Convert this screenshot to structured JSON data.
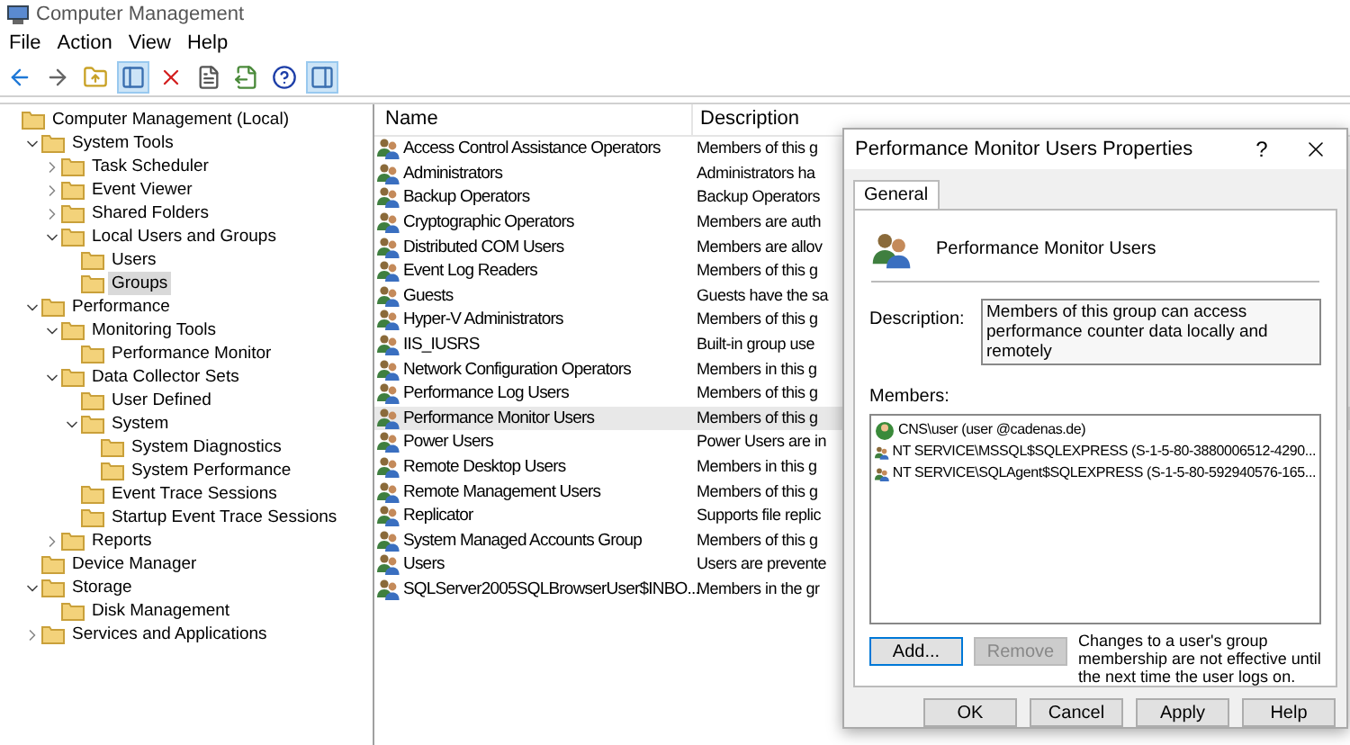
{
  "window": {
    "title": "Computer Management"
  },
  "menu": [
    "File",
    "Action",
    "View",
    "Help"
  ],
  "toolbar": [
    {
      "kind": "back",
      "on": false
    },
    {
      "kind": "forward",
      "on": false
    },
    {
      "kind": "up",
      "on": false
    },
    {
      "kind": "tree",
      "on": true
    },
    {
      "kind": "delete",
      "on": false
    },
    {
      "kind": "properties",
      "on": false
    },
    {
      "kind": "export",
      "on": false
    },
    {
      "kind": "help",
      "on": false
    },
    {
      "kind": "pane",
      "on": true
    }
  ],
  "tree": [
    {
      "label": "Computer Management (Local)",
      "selected": false,
      "children": [
        {
          "label": "System Tools",
          "selected": false,
          "expanded": true,
          "children": [
            {
              "label": "Task Scheduler",
              "selected": false,
              "expanded": false
            },
            {
              "label": "Event Viewer",
              "selected": false,
              "expanded": false
            },
            {
              "label": "Shared Folders",
              "selected": false,
              "expanded": false
            },
            {
              "label": "Local Users and Groups",
              "selected": false,
              "expanded": true,
              "children": [
                {
                  "label": "Users",
                  "selected": false
                },
                {
                  "label": "Groups",
                  "selected": true
                }
              ]
            }
          ]
        },
        {
          "label": "Performance",
          "selected": false,
          "expanded": true,
          "children": [
            {
              "label": "Monitoring Tools",
              "selected": false,
              "expanded": true,
              "children": [
                {
                  "label": "Performance Monitor",
                  "selected": false
                }
              ]
            },
            {
              "label": "Data Collector Sets",
              "selected": false,
              "expanded": true,
              "children": [
                {
                  "label": "User Defined",
                  "selected": false
                },
                {
                  "label": "System",
                  "selected": false,
                  "expanded": true,
                  "children": [
                    {
                      "label": "System Diagnostics",
                      "selected": false
                    },
                    {
                      "label": "System Performance",
                      "selected": false
                    }
                  ]
                },
                {
                  "label": "Event Trace Sessions",
                  "selected": false
                },
                {
                  "label": "Startup Event Trace Sessions",
                  "selected": false
                }
              ]
            },
            {
              "label": "Reports",
              "selected": false,
              "expanded": false
            }
          ]
        },
        {
          "label": "Device Manager",
          "selected": false
        },
        {
          "label": "Storage",
          "selected": false,
          "expanded": true,
          "children": [
            {
              "label": "Disk Management",
              "selected": false
            }
          ]
        },
        {
          "label": "Services and Applications",
          "selected": false,
          "expanded": false
        }
      ]
    }
  ],
  "table": {
    "columns": [
      "Name",
      "Description"
    ],
    "rows": [
      {
        "name": "Access Control Assistance Operators",
        "description": "Members of this g",
        "selected": false
      },
      {
        "name": "Administrators",
        "description": "Administrators ha",
        "selected": false
      },
      {
        "name": "Backup Operators",
        "description": "Backup Operators",
        "selected": false
      },
      {
        "name": "Cryptographic Operators",
        "description": "Members are auth",
        "selected": false
      },
      {
        "name": "Distributed COM Users",
        "description": "Members are allov",
        "selected": false
      },
      {
        "name": "Event Log Readers",
        "description": "Members of this g",
        "selected": false
      },
      {
        "name": "Guests",
        "description": "Guests have the sa",
        "selected": false
      },
      {
        "name": "Hyper-V Administrators",
        "description": "Members of this g",
        "selected": false
      },
      {
        "name": "IIS_IUSRS",
        "description": "Built-in group use",
        "selected": false
      },
      {
        "name": "Network Configuration Operators",
        "description": "Members in this g",
        "selected": false
      },
      {
        "name": "Performance Log Users",
        "description": "Members of this g",
        "selected": false
      },
      {
        "name": "Performance Monitor Users",
        "description": "Members of this g",
        "selected": true
      },
      {
        "name": "Power Users",
        "description": "Power Users are in",
        "selected": false
      },
      {
        "name": "Remote Desktop Users",
        "description": "Members in this g",
        "selected": false
      },
      {
        "name": "Remote Management Users",
        "description": "Members of this g",
        "selected": false
      },
      {
        "name": "Replicator",
        "description": "Supports file replic",
        "selected": false
      },
      {
        "name": "System Managed Accounts Group",
        "description": "Members of this g",
        "selected": false
      },
      {
        "name": "Users",
        "description": "Users are prevente",
        "selected": false
      },
      {
        "name": "SQLServer2005SQLBrowserUser$INBO...",
        "description": "Members in the gr",
        "selected": false
      }
    ]
  },
  "dialog": {
    "title": "Performance Monitor Users Properties",
    "help": "?",
    "tabs": [
      {
        "label": "General",
        "selected": true
      }
    ],
    "group_name": "Performance Monitor Users",
    "description_label": "Description:",
    "description": "Members of this group can access performance counter data locally and remotely",
    "members_label": "Members:",
    "members": [
      {
        "kind": "user",
        "text": "CNS\\user  (user @cadenas.de)"
      },
      {
        "kind": "service",
        "text": "NT SERVICE\\MSSQL$SQLEXPRESS (S-1-5-80-3880006512-4290..."
      },
      {
        "kind": "service",
        "text": "NT SERVICE\\SQLAgent$SQLEXPRESS (S-1-5-80-592940576-165..."
      }
    ],
    "add_button": {
      "label": "Add...",
      "disabled": false
    },
    "remove_button": {
      "label": "Remove",
      "disabled": true
    },
    "note": "Changes to a user's group membership are not effective until the next time the user logs on.",
    "buttons": [
      "OK",
      "Cancel",
      "Apply",
      "Help"
    ]
  }
}
